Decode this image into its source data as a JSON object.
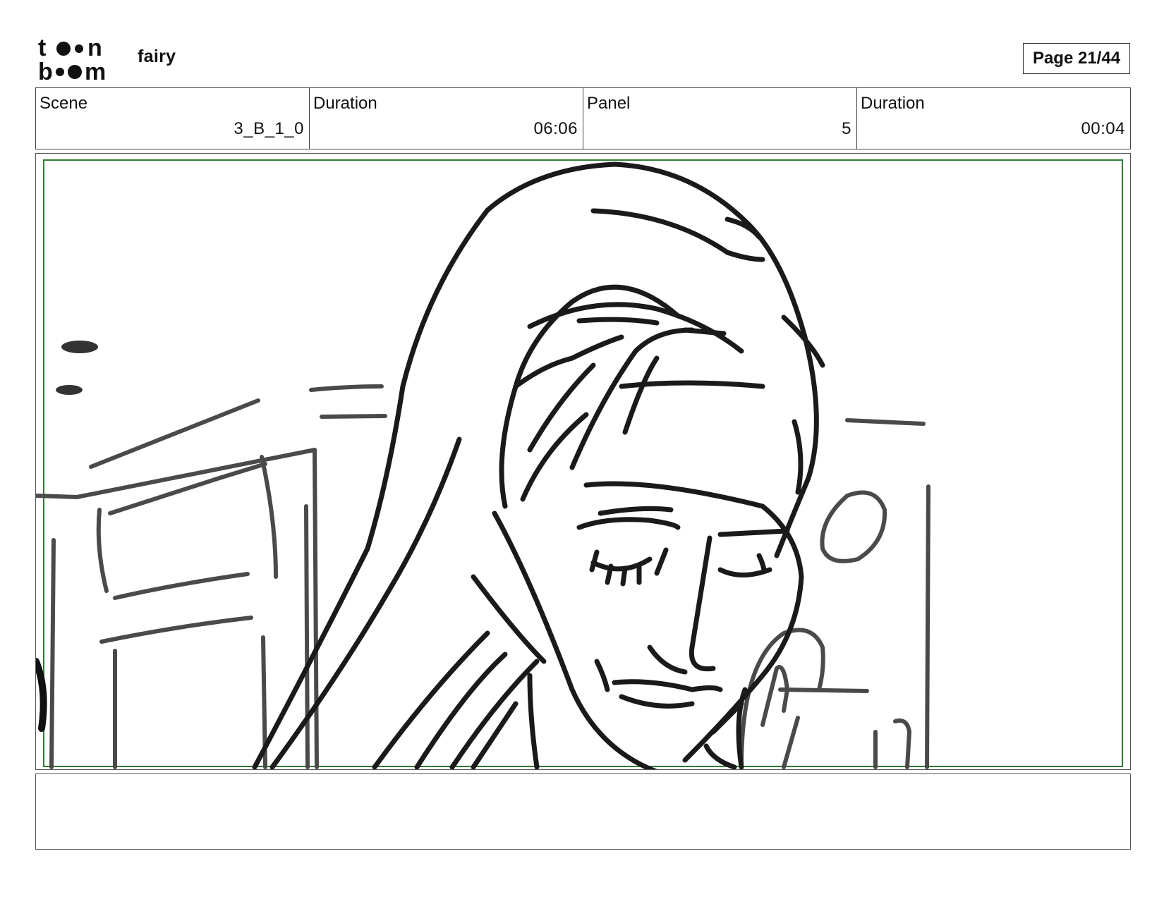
{
  "header": {
    "logo_text": "toon boom",
    "project_title": "fairy",
    "page_label": "Page 21/44"
  },
  "info": {
    "scene_label": "Scene",
    "scene_value": "3_B_1_0",
    "scene_duration_label": "Duration",
    "scene_duration_value": "06:06",
    "panel_label": "Panel",
    "panel_value": "5",
    "panel_duration_label": "Duration",
    "panel_duration_value": "00:04"
  },
  "panel": {
    "safe_frame_color": "#2e7d32",
    "stroke_color": "#1a1a1a",
    "background_stroke_color": "#4a4a4a"
  },
  "notes": {
    "text": ""
  }
}
